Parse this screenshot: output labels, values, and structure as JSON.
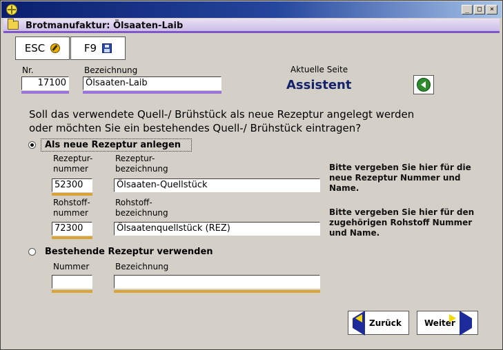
{
  "window": {
    "controls": [
      "_",
      "□",
      "×"
    ]
  },
  "caption": {
    "title": "Brotmanufaktur: Ölsaaten-Laib"
  },
  "toolbar": {
    "esc_label": "ESC",
    "f9_label": "F9"
  },
  "header": {
    "nr_label": "Nr.",
    "nr_value": "17100",
    "bez_label": "Bezeichnung",
    "bez_value": "Ölsaaten-Laib",
    "page_label": "Aktuelle Seite",
    "page_title": "Assistent"
  },
  "question": {
    "line1": "Soll das verwendete Quell-/ Brühstück als neue Rezeptur angelegt werden",
    "line2": "oder möchten Sie ein bestehendes Quell-/ Brühstück eintragen?"
  },
  "option_new": {
    "label": "Als neue Rezeptur anlegen",
    "selected": true,
    "rezeptur_nummer_label_1": "Rezeptur-",
    "rezeptur_nummer_label_2": "nummer",
    "rezeptur_bez_label_1": "Rezeptur-",
    "rezeptur_bez_label_2": "bezeichnung",
    "rezeptur_nummer": "52300",
    "rezeptur_bezeichnung": "Ölsaaten-Quellstück",
    "hint1_line1": "Bitte vergeben Sie hier für die",
    "hint1_line2": "neue Rezeptur Nummer und",
    "hint1_line3": "Name.",
    "rohstoff_nummer_label_1": "Rohstoff-",
    "rohstoff_nummer_label_2": "nummer",
    "rohstoff_bez_label_1": "Rohstoff-",
    "rohstoff_bez_label_2": "bezeichnung",
    "rohstoff_nummer": "72300",
    "rohstoff_bezeichnung": "Ölsaatenquellstück (REZ)",
    "hint2_line1": "Bitte vergeben Sie hier für den",
    "hint2_line2": "zugehörigen Rohstoff Nummer",
    "hint2_line3": "und Name."
  },
  "option_existing": {
    "label": "Bestehende Rezeptur verwenden",
    "selected": false,
    "nummer_label": "Nummer",
    "bezeichnung_label": "Bezeichnung",
    "nummer_value": "",
    "bezeichnung_value": ""
  },
  "nav": {
    "back_label": "Zurück",
    "next_label": "Weiter"
  }
}
